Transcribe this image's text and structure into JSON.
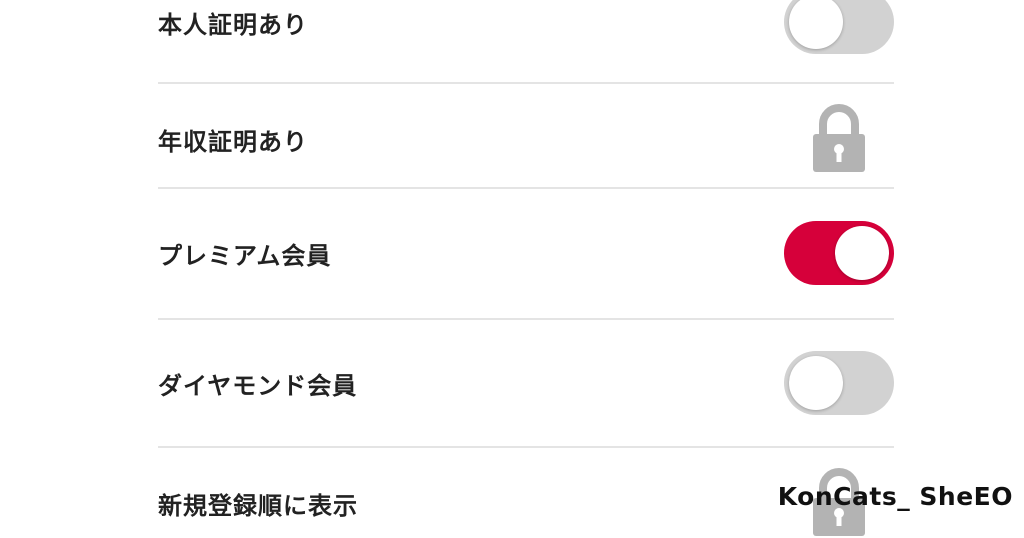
{
  "settings": {
    "items": [
      {
        "label": "本人証明あり",
        "control": "toggle",
        "state": "off"
      },
      {
        "label": "年収証明あり",
        "control": "lock-icon"
      },
      {
        "label": "プレミアム会員",
        "control": "toggle",
        "state": "on"
      },
      {
        "label": "ダイヤモンド会員",
        "control": "toggle",
        "state": "off"
      },
      {
        "label": "新規登録順に表示",
        "control": "lock-icon"
      }
    ]
  },
  "watermark": {
    "text": "KonCats_ SheEO"
  },
  "colors": {
    "toggle_on": "#d6003a",
    "toggle_off": "#d2d2d2",
    "lock": "#b3b3b3",
    "divider": "#e4e4e4",
    "label_text": "#222222"
  }
}
